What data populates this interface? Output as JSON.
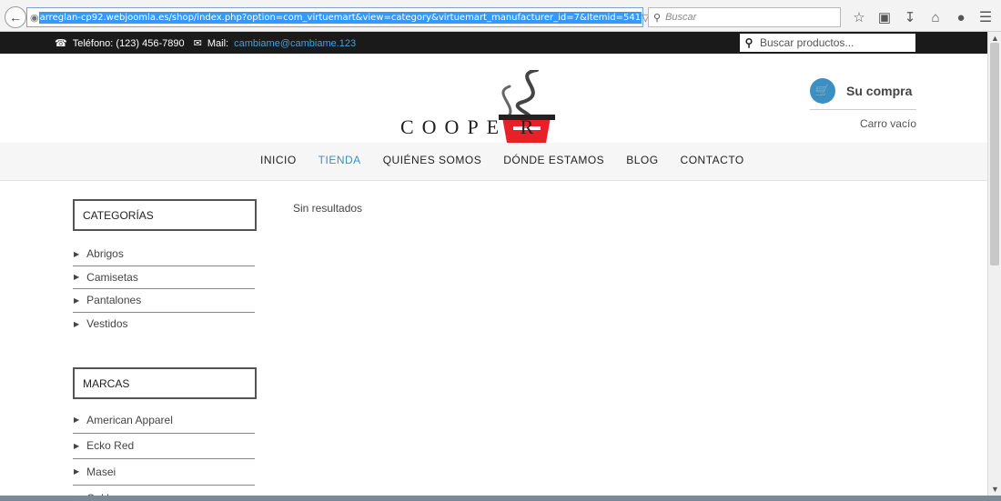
{
  "browser": {
    "url": "arreglan-cp92.webjoomla.es/shop/index.php?option=com_virtuemart&view=category&virtuemart_manufacturer_id=7&Itemid=541",
    "search_placeholder": "Buscar"
  },
  "topbar": {
    "phone": "Teléfono: (123) 456-7890",
    "mail_label": "Mail:",
    "mail": "cambiame@cambiame.123",
    "search_placeholder": "Buscar productos..."
  },
  "header": {
    "logo_text": "COOPE    R",
    "cart_title": "Su compra",
    "cart_status": "Carro vacío"
  },
  "nav": {
    "items": [
      "INICIO",
      "TIENDA",
      "QUIÉNES SOMOS",
      "DÓNDE ESTAMOS",
      "BLOG",
      "CONTACTO"
    ],
    "active": "TIENDA"
  },
  "sidebar": {
    "categories_title": "CATEGORÍAS",
    "categories": [
      "Abrigos",
      "Camisetas",
      "Pantalones",
      "Vestidos"
    ],
    "brands_title": "MARCAS",
    "brands": [
      "American Apparel",
      "Ecko Red",
      "Masei",
      "Oakley"
    ]
  },
  "main": {
    "message": "Sin resultados"
  },
  "colors": {
    "accent": "#3a8fc3",
    "topbar_bg": "#1a1a1a",
    "logo_red": "#e8202a"
  }
}
